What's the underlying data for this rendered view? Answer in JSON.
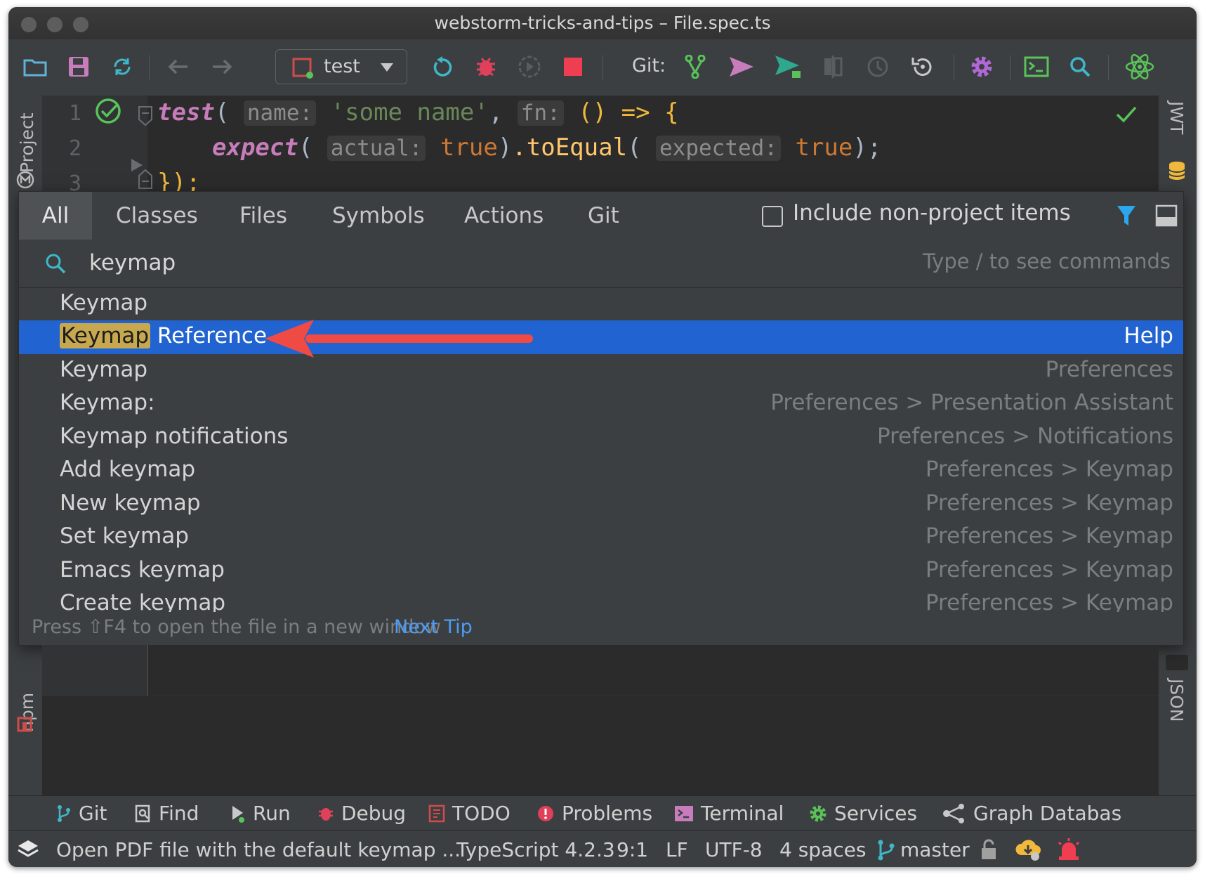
{
  "window": {
    "title": "webstorm-tricks-and-tips – File.spec.ts"
  },
  "toolbar": {
    "run_config": "test",
    "git_label": "Git:",
    "icons": [
      "folder-open-icon",
      "save-icon",
      "sync-icon",
      "back-icon",
      "forward-icon",
      "rerun-icon",
      "debug-icon",
      "coverage-icon",
      "stop-icon",
      "git-branch-icon",
      "commit-icon",
      "push-icon",
      "diff-icon",
      "history-icon",
      "rollback-icon",
      "settings-icon",
      "terminal-icon",
      "search-icon",
      "react-icon"
    ]
  },
  "editor": {
    "lines": [
      {
        "num": "1",
        "fn": "test",
        "hint1": "name:",
        "str": "'some name'",
        "hint2": "fn:",
        "rest": "() => {"
      },
      {
        "num": "2",
        "fn": "expect",
        "hint1": "actual:",
        "lit1": "true",
        "method": ".toEqual",
        "hint2": "expected:",
        "lit2": "true",
        "end": ");"
      },
      {
        "num": "3",
        "close": "});"
      }
    ]
  },
  "side_panels": {
    "left_top": "Project",
    "left_bottom": "npm",
    "right_top": "JWT",
    "right_bottom": "JSON"
  },
  "search_everywhere": {
    "tabs": [
      "All",
      "Classes",
      "Files",
      "Symbols",
      "Actions",
      "Git"
    ],
    "selected_tab": "All",
    "include_label": "Include non-project items",
    "query": "keymap",
    "query_hint": "Type / to see commands",
    "results": [
      {
        "title": "Keymap",
        "location": ""
      },
      {
        "title_match": "Keymap",
        "title_rest": " Reference",
        "location": "Help"
      },
      {
        "title": "Keymap",
        "location": "Preferences"
      },
      {
        "title": "Keymap:",
        "location": "Preferences > Presentation Assistant"
      },
      {
        "title": "Keymap notifications",
        "location": "Preferences > Notifications"
      },
      {
        "title": "Add keymap",
        "location": "Preferences > Keymap"
      },
      {
        "title": "New keymap",
        "location": "Preferences > Keymap"
      },
      {
        "title": "Set keymap",
        "location": "Preferences > Keymap"
      },
      {
        "title": "Emacs keymap",
        "location": "Preferences > Keymap"
      },
      {
        "title": "Create keymap",
        "location": "Preferences > Keymap"
      }
    ],
    "tip": "Press ⇧F4 to open the file in a new window",
    "next_tip": "Next Tip"
  },
  "tool_windows": [
    "Git",
    "Find",
    "Run",
    "Debug",
    "TODO",
    "Problems",
    "Terminal",
    "Services",
    "Graph Databas"
  ],
  "status": {
    "message": "Open PDF file with the default keymap ...",
    "language": "TypeScript 4.2.3",
    "position": "9:1",
    "line_sep": "LF",
    "encoding": "UTF-8",
    "indent": "4 spaces",
    "branch": "master"
  },
  "colors": {
    "accent": "#2163d0",
    "arrow": "#ef4b44",
    "link": "#4a9cf5"
  }
}
